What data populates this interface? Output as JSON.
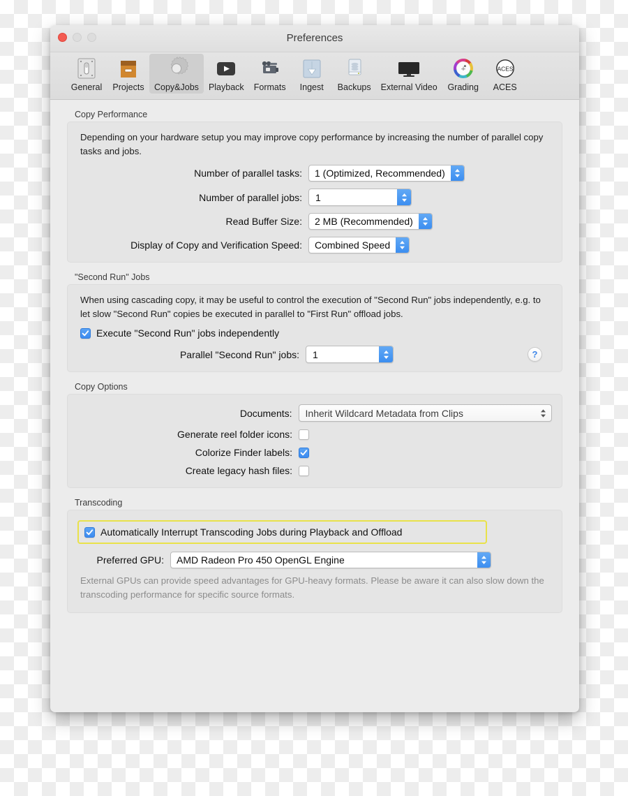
{
  "window": {
    "title": "Preferences",
    "traffic_lights": [
      "close",
      "minimize",
      "maximize"
    ]
  },
  "toolbar": {
    "items": [
      {
        "label": "General",
        "icon": "general-switch-icon",
        "selected": false
      },
      {
        "label": "Projects",
        "icon": "projects-box-icon",
        "selected": false
      },
      {
        "label": "Copy&Jobs",
        "icon": "gear-icon",
        "selected": true
      },
      {
        "label": "Playback",
        "icon": "play-button-icon",
        "selected": false
      },
      {
        "label": "Formats",
        "icon": "video-camera-icon",
        "selected": false
      },
      {
        "label": "Ingest",
        "icon": "download-arrow-icon",
        "selected": false
      },
      {
        "label": "Backups",
        "icon": "hard-drive-icon",
        "selected": false
      },
      {
        "label": "External Video",
        "icon": "monitor-icon",
        "selected": false
      },
      {
        "label": "Grading",
        "icon": "color-wheel-icon",
        "selected": false
      },
      {
        "label": "ACES",
        "icon": "aces-circle-icon",
        "selected": false
      }
    ]
  },
  "copy_performance": {
    "title": "Copy Performance",
    "description": "Depending on your hardware setup you may improve copy performance by increasing the number of parallel copy tasks and jobs.",
    "parallel_tasks": {
      "label": "Number of parallel tasks:",
      "value": "1 (Optimized, Recommended)"
    },
    "parallel_jobs": {
      "label": "Number of parallel jobs:",
      "value": "1"
    },
    "read_buffer": {
      "label": "Read Buffer Size:",
      "value": "2 MB (Recommended)"
    },
    "speed_display": {
      "label": "Display of Copy and Verification Speed:",
      "value": "Combined Speed"
    }
  },
  "second_run": {
    "title": "\"Second Run\" Jobs",
    "description": "When using cascading copy, it may be useful to control the execution of \"Second Run\" jobs independently, e.g. to let slow \"Second Run\" copies be executed in parallel to \"First Run\" offload jobs.",
    "execute_independently": {
      "label": "Execute \"Second Run\" jobs independently",
      "checked": true
    },
    "parallel_jobs": {
      "label": "Parallel \"Second Run\" jobs:",
      "value": "1"
    },
    "help_label": "?"
  },
  "copy_options": {
    "title": "Copy Options",
    "documents": {
      "label": "Documents:",
      "value": "Inherit Wildcard Metadata from Clips"
    },
    "reel_folder_icons": {
      "label": "Generate reel folder icons:",
      "checked": false
    },
    "colorize_finder_labels": {
      "label": "Colorize Finder labels:",
      "checked": true
    },
    "legacy_hash_files": {
      "label": "Create legacy hash files:",
      "checked": false
    }
  },
  "transcoding": {
    "title": "Transcoding",
    "auto_interrupt": {
      "label": "Automatically Interrupt Transcoding Jobs during Playback and Offload",
      "checked": true,
      "highlight_color": "#e9e24a"
    },
    "preferred_gpu": {
      "label": "Preferred GPU:",
      "value": "AMD Radeon Pro 450 OpenGL Engine"
    },
    "note": "External GPUs can provide speed advantages for GPU-heavy formats. Please be aware it can also slow down the transcoding performance for specific source formats."
  },
  "colors": {
    "accent_blue": "#3d8cf0",
    "window_bg": "#ececec",
    "group_bg": "#e5e5e5",
    "highlight_yellow": "#e9e24a"
  }
}
